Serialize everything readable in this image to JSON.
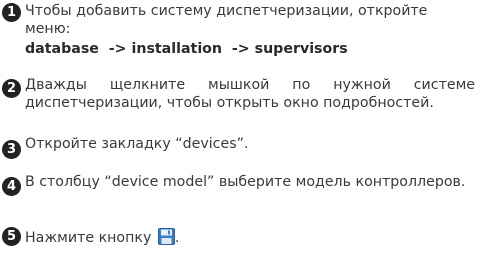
{
  "steps": [
    {
      "number": "1",
      "text": "Чтобы добавить систему диспетчеризации, откройте меню:",
      "command": "database  -> installation  -> supervisors"
    },
    {
      "number": "2",
      "text": "Дважды щелкните мышкой по нужной системе диспетчеризации, чтобы открыть окно подробностей."
    },
    {
      "number": "3",
      "text": "Откройте закладку “devices”."
    },
    {
      "number": "4",
      "text": "В столбцу “device model” выберите модель контроллеров."
    },
    {
      "number": "5",
      "text": "Нажмите кнопку",
      "text_after": ".",
      "icon": "save-icon"
    }
  ],
  "colors": {
    "text": "#3a3a3a",
    "badge": "#222222",
    "icon_blue": "#3b7cc9"
  }
}
